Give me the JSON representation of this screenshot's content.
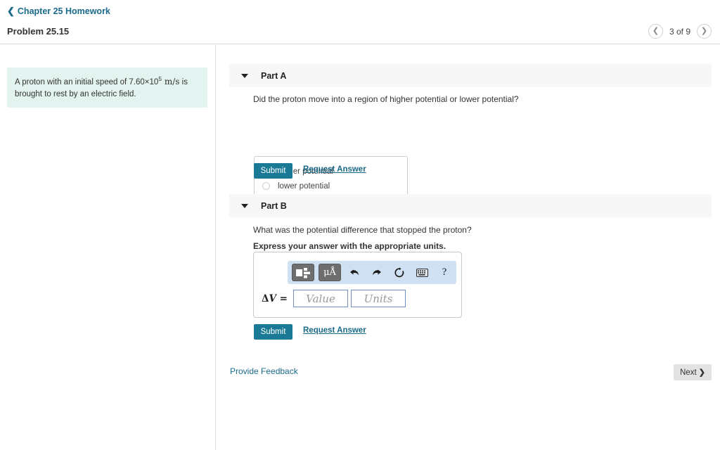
{
  "header": {
    "breadcrumb_label": "Chapter 25 Homework",
    "breadcrumb_icon": "chevron-left-icon",
    "problem_title": "Problem 25.15",
    "pager": {
      "prev_icon": "chevron-left-icon",
      "next_icon": "chevron-right-icon",
      "position_label": "3 of 9"
    }
  },
  "problem": {
    "text_before": "A proton with an initial speed of 7.60×10",
    "exponent": "5",
    "units": "m/s",
    "text_after": " is brought to rest by an electric field."
  },
  "parts": {
    "a": {
      "label": "Part A",
      "caret_icon": "caret-down-icon",
      "question": "Did the proton move into a region of higher potential or lower potential?",
      "choices": [
        {
          "label": "higher potential",
          "selected": false
        },
        {
          "label": "lower potential",
          "selected": false
        }
      ],
      "submit_label": "Submit",
      "request_answer_label": "Request Answer"
    },
    "b": {
      "label": "Part B",
      "caret_icon": "caret-down-icon",
      "question": "What was the potential difference that stopped the proton?",
      "instruction": "Express your answer with the appropriate units.",
      "answer": {
        "variable_delta": "Δ",
        "variable_name": "V",
        "equals": "=",
        "value_placeholder": "Value",
        "units_placeholder": "Units",
        "value": "",
        "units": ""
      },
      "toolbar": {
        "template_icon": "math-template-icon",
        "units_label": "μÅ",
        "units_icon": "units-icon",
        "undo_icon": "undo-arrow-icon",
        "redo_icon": "redo-arrow-icon",
        "reset_icon": "reset-circle-icon",
        "keyboard_icon": "keyboard-icon",
        "help_label": "?",
        "help_icon": "help-question-icon"
      },
      "submit_label": "Submit",
      "request_answer_label": "Request Answer"
    }
  },
  "footer": {
    "feedback_label": "Provide Feedback",
    "next_label": "Next",
    "next_icon": "chevron-right-icon"
  },
  "colors": {
    "accent_teal": "#1a7a96",
    "link_blue": "#1a6a8a",
    "statement_bg": "#e3f3f0",
    "part_header_bg": "#f7f7f7",
    "toolbar_bg": "#cfe0f2",
    "field_border": "#6f8fc4",
    "next_btn_bg": "#e3e3e3"
  }
}
